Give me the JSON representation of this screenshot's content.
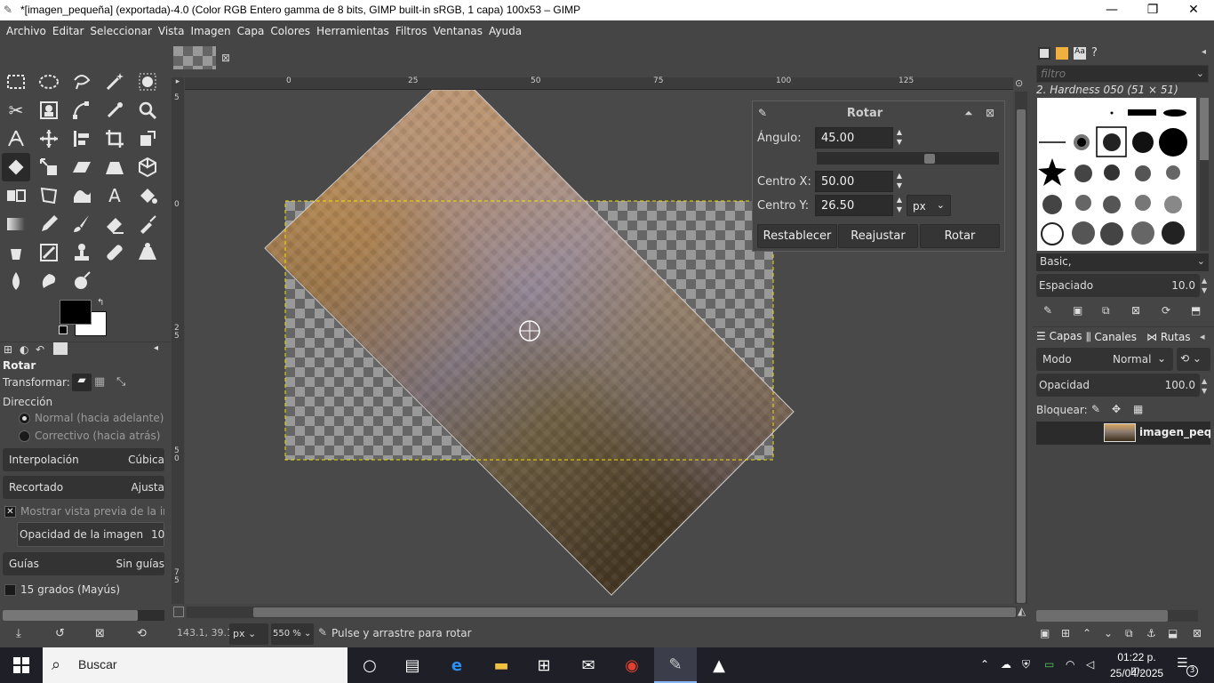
{
  "window": {
    "title": "*[imagen_pequeña] (exportada)-4.0 (Color RGB Entero gamma de 8 bits, GIMP built-in sRGB, 1 capa) 100x53 – GIMP",
    "controls": [
      "—",
      "❐",
      "✕"
    ]
  },
  "menubar": [
    "Archivo",
    "Editar",
    "Seleccionar",
    "Vista",
    "Imagen",
    "Capa",
    "Colores",
    "Herramientas",
    "Filtros",
    "Ventanas",
    "Ayuda"
  ],
  "tool_options": {
    "title": "Rotar",
    "transform_label": "Transformar:",
    "direction_label": "Dirección",
    "direction_normal": "Normal (hacia adelante)",
    "direction_corrective": "Correctivo (hacia atrás)",
    "interpolation_label": "Interpolación",
    "interpolation_value": "Cúbica",
    "clipping_label": "Recortado",
    "clipping_value": "Ajusta",
    "show_preview": "Mostrar vista previa de la im",
    "image_opacity_label": "Opacidad de la imagen",
    "image_opacity_value": "10",
    "guides_label": "Guías",
    "guides_value": "Sin guías",
    "fifteen_degrees": "15 grados (Mayús)"
  },
  "rulers": {
    "top": [
      "0",
      "25",
      "50",
      "75",
      "100",
      "125"
    ],
    "left": [
      "5",
      "0",
      "2\n5",
      "5\n0",
      "7\n5"
    ]
  },
  "rotate_dialog": {
    "title": "Rotar",
    "angle_label": "Ángulo:",
    "angle_value": "45.00",
    "angle_fraction": 0.625,
    "center_x_label": "Centro X:",
    "center_x_value": "50.00",
    "center_y_label": "Centro Y:",
    "center_y_value": "26.50",
    "unit": "px",
    "reset_button": "Restablecer",
    "readjust_button": "Reajustar",
    "rotate_button": "Rotar"
  },
  "brushes": {
    "filter_placeholder": "filtro",
    "selected_brush": "2. Hardness 050 (51 × 51)",
    "tag": "Basic,",
    "spacing_label": "Espaciado",
    "spacing_value": "10.0"
  },
  "layers": {
    "tabs": [
      "Capas",
      "Canales",
      "Rutas"
    ],
    "mode_label": "Modo",
    "mode_value": "Normal",
    "opacity_label": "Opacidad",
    "opacity_value": "100.0",
    "lock_label": "Bloquear:",
    "layer_name": "imagen_pequ"
  },
  "statusbar": {
    "coords": "143.1, 39.1",
    "unit": "px",
    "zoom": "550 %",
    "message": "Pulse y arrastre para rotar"
  },
  "taskbar": {
    "search_placeholder": "Buscar",
    "time": "01:22 p. m.",
    "date": "25/04/2025",
    "notification_count": "3"
  },
  "colors": {
    "bg": "#454545",
    "field": "#333333",
    "taskbar": "#1e1f27",
    "selection": "#f0e000"
  }
}
